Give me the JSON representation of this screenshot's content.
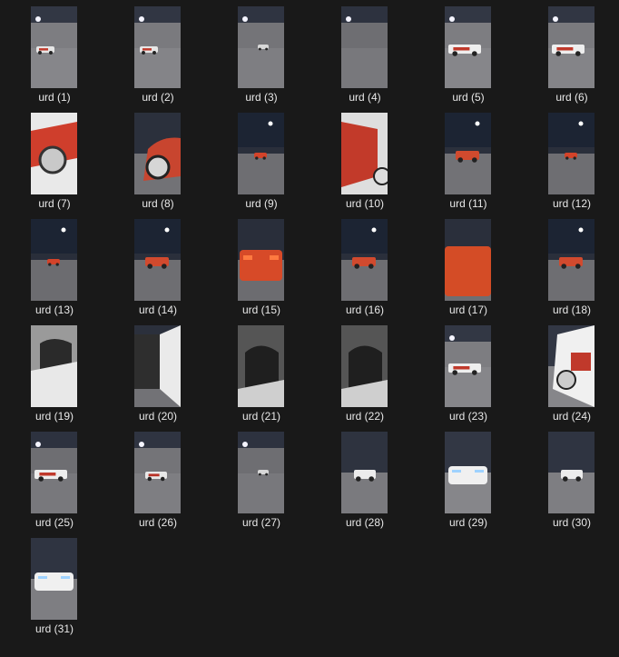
{
  "files": [
    {
      "name": "urd (1)",
      "scene": "wide-car",
      "bright": 0.62
    },
    {
      "name": "urd (2)",
      "scene": "wide-car",
      "bright": 0.6
    },
    {
      "name": "urd (3)",
      "scene": "wide-far",
      "bright": 0.55
    },
    {
      "name": "urd (4)",
      "scene": "empty",
      "bright": 0.5
    },
    {
      "name": "urd (5)",
      "scene": "wide-livery",
      "bright": 0.62
    },
    {
      "name": "urd (6)",
      "scene": "wide-livery",
      "bright": 0.6
    },
    {
      "name": "urd (7)",
      "scene": "wheel-close",
      "bright": 0.7
    },
    {
      "name": "urd (8)",
      "scene": "wheel-red",
      "bright": 0.45
    },
    {
      "name": "urd (9)",
      "scene": "night-red-far",
      "bright": 0.42
    },
    {
      "name": "urd (10)",
      "scene": "door-close",
      "bright": 0.6
    },
    {
      "name": "urd (11)",
      "scene": "night-red-mid",
      "bright": 0.45
    },
    {
      "name": "urd (12)",
      "scene": "night-red-far",
      "bright": 0.42
    },
    {
      "name": "urd (13)",
      "scene": "night-red-far",
      "bright": 0.4
    },
    {
      "name": "urd (14)",
      "scene": "night-red-mid",
      "bright": 0.42
    },
    {
      "name": "urd (15)",
      "scene": "red-rear",
      "bright": 0.4
    },
    {
      "name": "urd (16)",
      "scene": "night-red-mid",
      "bright": 0.42
    },
    {
      "name": "urd (17)",
      "scene": "red-rear-close",
      "bright": 0.42
    },
    {
      "name": "urd (18)",
      "scene": "night-red-mid",
      "bright": 0.42
    },
    {
      "name": "urd (19)",
      "scene": "interior-white",
      "bright": 0.55
    },
    {
      "name": "urd (20)",
      "scene": "interior-open",
      "bright": 0.45
    },
    {
      "name": "urd (21)",
      "scene": "interior-dark",
      "bright": 0.45
    },
    {
      "name": "urd (22)",
      "scene": "interior-dark",
      "bright": 0.45
    },
    {
      "name": "urd (23)",
      "scene": "wide-livery",
      "bright": 0.62
    },
    {
      "name": "urd (24)",
      "scene": "door-livery",
      "bright": 0.62
    },
    {
      "name": "urd (25)",
      "scene": "wide-livery",
      "bright": 0.5
    },
    {
      "name": "urd (26)",
      "scene": "wide-white",
      "bright": 0.55
    },
    {
      "name": "urd (27)",
      "scene": "wide-far",
      "bright": 0.5
    },
    {
      "name": "urd (28)",
      "scene": "white-front-mid",
      "bright": 0.52
    },
    {
      "name": "urd (29)",
      "scene": "white-front-close",
      "bright": 0.62
    },
    {
      "name": "urd (30)",
      "scene": "white-front-mid",
      "bright": 0.55
    },
    {
      "name": "urd (31)",
      "scene": "white-front-close",
      "bright": 0.55
    }
  ]
}
